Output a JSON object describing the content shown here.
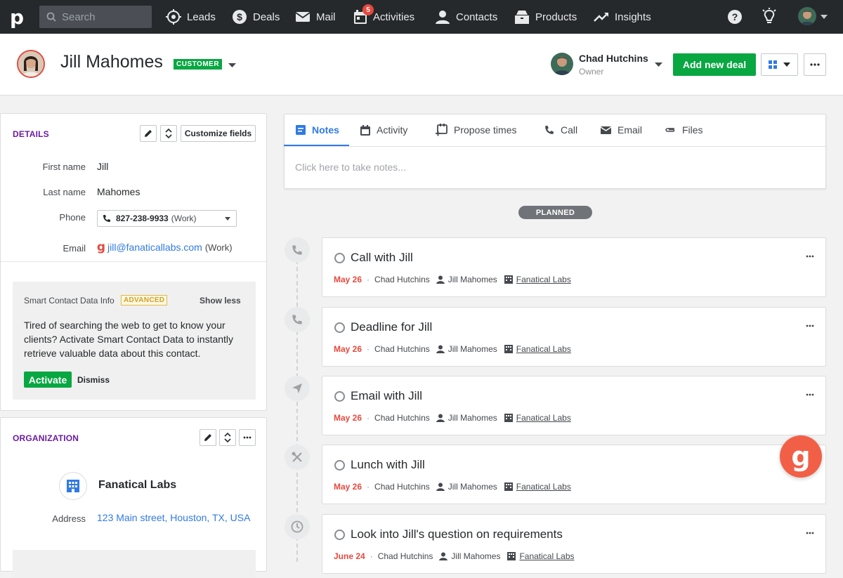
{
  "topbar": {
    "logo": "p",
    "search_placeholder": "Search",
    "nav": [
      {
        "label": "Leads",
        "icon": "target-icon"
      },
      {
        "label": "Deals",
        "icon": "dollar-icon"
      },
      {
        "label": "Mail",
        "icon": "mail-icon"
      },
      {
        "label": "Activities",
        "icon": "calendar-icon",
        "badge": "5"
      },
      {
        "label": "Contacts",
        "icon": "person-icon"
      },
      {
        "label": "Products",
        "icon": "box-icon"
      },
      {
        "label": "Insights",
        "icon": "trend-icon"
      }
    ]
  },
  "header": {
    "name": "Jill Mahomes",
    "badge": "CUSTOMER",
    "owner_name": "Chad Hutchins",
    "owner_label": "Owner",
    "add_deal": "Add new deal"
  },
  "details": {
    "title": "DETAILS",
    "customize": "Customize fields",
    "first_name_label": "First name",
    "first_name": "Jill",
    "last_name_label": "Last name",
    "last_name": "Mahomes",
    "phone_label": "Phone",
    "phone": "827-238-9933",
    "phone_type": "(Work)",
    "email_label": "Email",
    "email": "jill@fanaticallabs.com",
    "email_type": "(Work)"
  },
  "smart": {
    "title": "Smart Contact Data Info",
    "badge": "ADVANCED",
    "show_less": "Show less",
    "body": "Tired of searching the web to get to know your clients? Activate Smart Contact Data to instantly retrieve valuable data about this contact.",
    "activate": "Activate",
    "dismiss": "Dismiss"
  },
  "organization": {
    "title": "ORGANIZATION",
    "name": "Fanatical Labs",
    "address_label": "Address",
    "address": "123 Main street, Houston, TX, USA"
  },
  "tabs": [
    {
      "label": "Notes",
      "icon": "notes-icon"
    },
    {
      "label": "Activity",
      "icon": "calendar-icon"
    },
    {
      "label": "Propose times",
      "icon": "calendar-plus-icon"
    },
    {
      "label": "Call",
      "icon": "phone-icon"
    },
    {
      "label": "Email",
      "icon": "mail-icon"
    },
    {
      "label": "Files",
      "icon": "paperclip-icon"
    }
  ],
  "notes_placeholder": "Click here to take notes...",
  "planned_label": "PLANNED",
  "activities": [
    {
      "title": "Call with Jill",
      "date": "May 26",
      "owner": "Chad Hutchins",
      "person": "Jill Mahomes",
      "org": "Fanatical Labs",
      "icon": "phone-icon"
    },
    {
      "title": "Deadline for Jill",
      "date": "May 26",
      "owner": "Chad Hutchins",
      "person": "Jill Mahomes",
      "org": "Fanatical Labs",
      "icon": "phone-icon"
    },
    {
      "title": "Email with Jill",
      "date": "May 26",
      "owner": "Chad Hutchins",
      "person": "Jill Mahomes",
      "org": "Fanatical Labs",
      "icon": "send-icon"
    },
    {
      "title": "Lunch with Jill",
      "date": "May 26",
      "owner": "Chad Hutchins",
      "person": "Jill Mahomes",
      "org": "Fanatical Labs",
      "icon": "fork-knife-icon"
    },
    {
      "title": "Look into Jill's question on requirements",
      "date": "June 24",
      "owner": "Chad Hutchins",
      "person": "Jill Mahomes",
      "org": "Fanatical Labs",
      "icon": "clock-icon"
    }
  ],
  "chat_fab_glyph": "g",
  "colors": {
    "accent_green": "#08a742",
    "link_blue": "#317ae2",
    "section_purple": "#6b1ba0",
    "date_red": "#e6493e",
    "fab": "#f25f47"
  }
}
